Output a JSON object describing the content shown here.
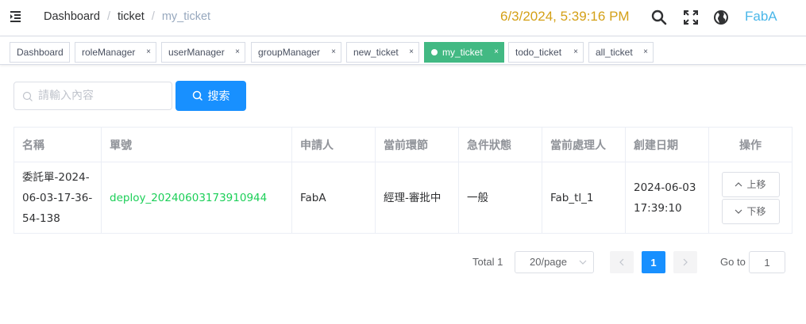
{
  "navbar": {
    "breadcrumb": [
      "Dashboard",
      "ticket",
      "my_ticket"
    ],
    "datetime": "6/3/2024, 5:39:16 PM",
    "username": "FabA",
    "icons": [
      "hamburger-icon",
      "search-icon",
      "fullscreen-icon",
      "globe-icon"
    ],
    "datetime_color": "#d4a017",
    "username_color": "#4ab7e9"
  },
  "tags": [
    {
      "label": "Dashboard",
      "closable": false,
      "active": false
    },
    {
      "label": "roleManager",
      "closable": true,
      "active": false
    },
    {
      "label": "userManager",
      "closable": true,
      "active": false
    },
    {
      "label": "groupManager",
      "closable": true,
      "active": false
    },
    {
      "label": "new_ticket",
      "closable": true,
      "active": false
    },
    {
      "label": "my_ticket",
      "closable": true,
      "active": true
    },
    {
      "label": "todo_ticket",
      "closable": true,
      "active": false
    },
    {
      "label": "all_ticket",
      "closable": true,
      "active": false
    }
  ],
  "tag_close_glyph": "×",
  "search": {
    "placeholder": "請輸入內容",
    "button_label": "搜索"
  },
  "table": {
    "headers": [
      "名稱",
      "單號",
      "申請人",
      "當前環節",
      "急件狀態",
      "當前處理人",
      "創建日期",
      "操作"
    ],
    "rows": [
      {
        "name": "委託單-2024-06-03-17-36-54-138",
        "ticket_no": "deploy_20240603173910944",
        "applicant": "FabA",
        "stage": "經理-審批中",
        "urgency": "一般",
        "handler": "Fab_tl_1",
        "created": "2024-06-03 17:39:10",
        "actions": {
          "up": "上移",
          "down": "下移"
        }
      }
    ]
  },
  "pagination": {
    "total_label": "Total 1",
    "page_size": "20/page",
    "current_page": "1",
    "goto_label": "Go to",
    "goto_value": "1"
  },
  "colors": {
    "accent": "#1890ff",
    "active_tag": "#42b983",
    "link": "#1ccf58"
  }
}
